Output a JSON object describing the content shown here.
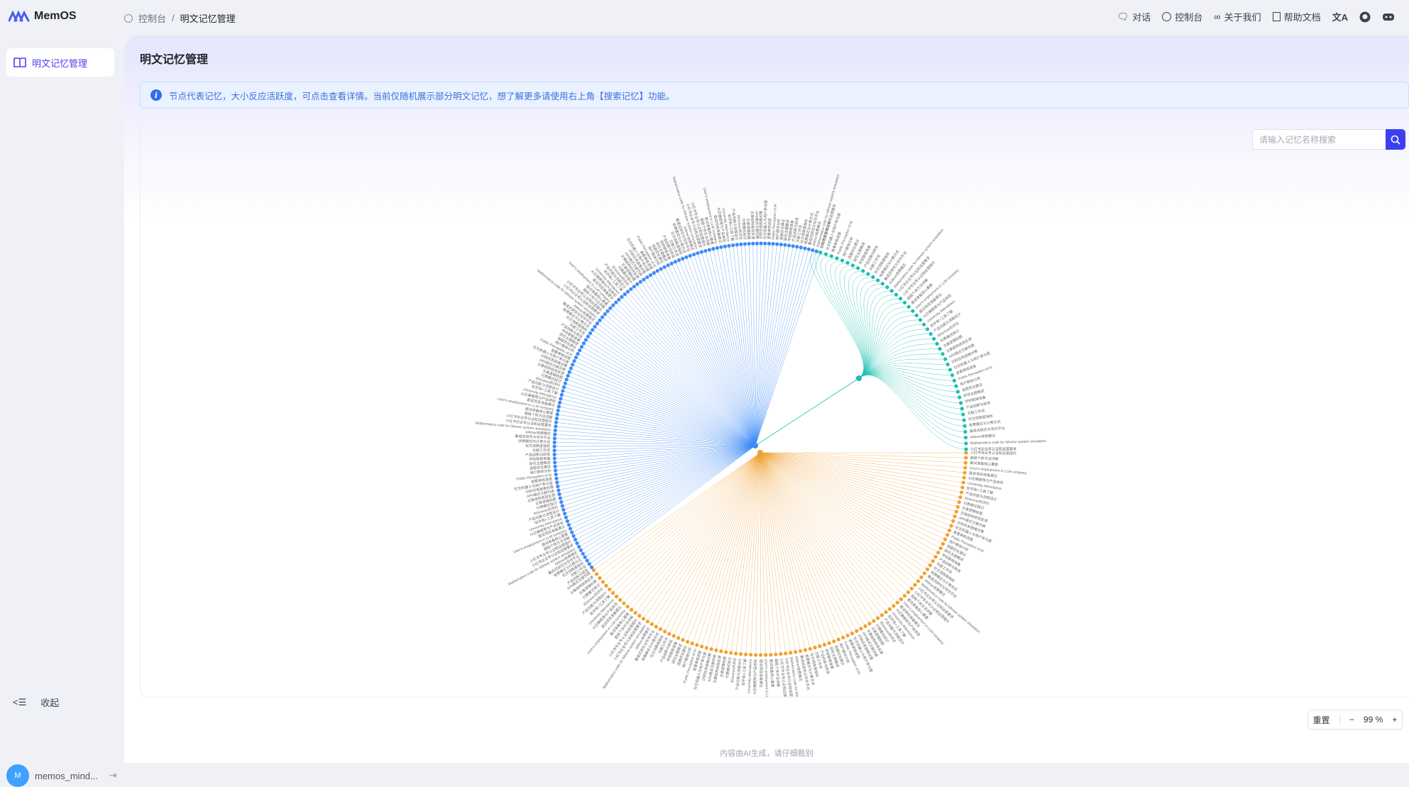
{
  "app": {
    "name": "MemOS"
  },
  "breadcrumb": {
    "root": "控制台",
    "sep": "/",
    "current": "明文记忆管理"
  },
  "topnav": {
    "chat": "对话",
    "console": "控制台",
    "about": "关于我们",
    "docs": "帮助文档"
  },
  "sidebar": {
    "items": [
      {
        "label": "明文记忆管理"
      }
    ],
    "collapse": "收起",
    "user": {
      "initial": "M",
      "name": "memos_mind..."
    }
  },
  "page": {
    "title": "明文记忆管理",
    "info": "节点代表记忆，大小反应活跃度，可点击查看详情。当前仅随机展示部分明文记忆，想了解更多请使用右上角【搜索记忆】功能。"
  },
  "search": {
    "placeholder": "请输入记忆名称搜索"
  },
  "zoom": {
    "reset": "重置",
    "minus": "−",
    "value": "99 %",
    "plus": "+"
  },
  "footer": "内容由AI生成，请仔细甄别",
  "graph": {
    "colors": {
      "blue": "#3d8bf5",
      "orange": "#f0a030",
      "teal": "#19c0b0"
    },
    "groups": [
      {
        "name": "blue",
        "count": 128
      },
      {
        "name": "orange",
        "count": 104
      },
      {
        "name": "teal",
        "count": 46
      }
    ],
    "labels": [
      "产品创新与研发",
      "文献工作流",
      "社交测跌度指标",
      "收费模式与计费方式",
      "集成式研究与写作平台",
      "AMiner收费模式",
      "Mathematica code for bilinear system simulation",
      "小红书企业号认证和运营要求",
      "小红书专业号认证和运营提升",
      "超级个体方法详解",
      "面试准备核心要素",
      "User's employment in LLM company",
      "面试项目准备建议",
      "AI正确使用与产品体验",
      "University Attendance",
      "知乎和+工具了解",
      "产品功能与流程设计",
      "对Aminer的评价",
      "付费模式探讨",
      "文章逻辑标题",
      "文章结构修改反馈",
      "APA格式文献列表",
      "识别任务困难对策",
      "社交机器人与用户参与度",
      "查看审核进度",
      "Public Perception of AI",
      "用户群体分析",
      "选题优化建议",
      "研究主题概述",
      "学校联络准备"
    ]
  }
}
